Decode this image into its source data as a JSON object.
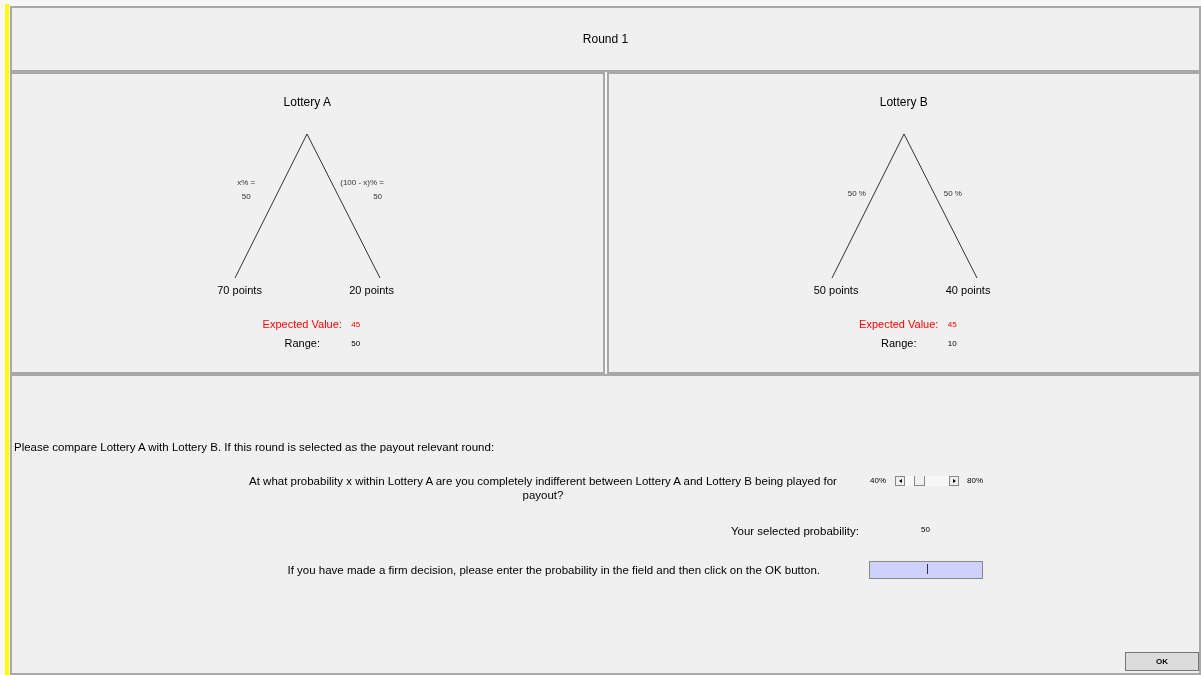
{
  "header": {
    "title": "Round 1"
  },
  "lotteries": [
    {
      "title": "Lottery A",
      "branches": [
        {
          "label": "x% =",
          "value": "50",
          "outcome": "70 points"
        },
        {
          "label": "(100 - x)% =",
          "value": "50",
          "outcome": "20 points"
        }
      ],
      "stats": [
        {
          "label": "Expected Value:",
          "value": "45",
          "color": "#ff0000"
        },
        {
          "label": "Range:",
          "value": "50",
          "color": "#000000"
        }
      ]
    },
    {
      "title": "Lottery B",
      "branches": [
        {
          "label": "50 %",
          "outcome": "50 points"
        },
        {
          "label": "50 %",
          "outcome": "40 points"
        }
      ],
      "stats": [
        {
          "label": "Expected Value:",
          "value": "45",
          "color": "#ff0000"
        },
        {
          "label": "Range:",
          "value": "10",
          "color": "#000000"
        }
      ]
    }
  ],
  "instruction": "Please compare Lottery A with Lottery B. If this round is selected as the payout relevant round:",
  "question": "At what probability x within Lottery A are you completely indifferent between Lottery A and Lottery B being played for payout?",
  "slider": {
    "min_label": "40%",
    "max_label": "80%"
  },
  "selected": {
    "label": "Your selected probability:",
    "value": "50"
  },
  "entry": {
    "label": "If you have made a firm decision, please enter the probability in the field and then click on the OK button."
  },
  "ok_button": "OK"
}
